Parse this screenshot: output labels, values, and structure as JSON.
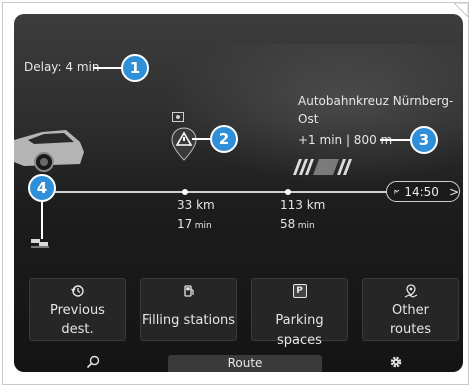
{
  "delay": {
    "label": "Delay: 4 min"
  },
  "destination": {
    "name_line1": "Autobahnkreuz Nürnberg-",
    "name_line2": "Ost",
    "info": "+1 min | 800 m"
  },
  "eta": {
    "time": "14:50",
    "arrow": ">"
  },
  "waypoints": [
    {
      "distance": "33 km",
      "time_value": "17",
      "time_unit": "min"
    },
    {
      "distance": "113 km",
      "time_value": "58",
      "time_unit": "min"
    }
  ],
  "callouts": [
    "1",
    "2",
    "3",
    "4"
  ],
  "actions": [
    {
      "label_line1": "Previous",
      "label_line2": "dest.",
      "icon": "history-icon"
    },
    {
      "label_line1": "Filling stations",
      "label_line2": "",
      "icon": "fuel-icon"
    },
    {
      "label_line1": "Parking spaces",
      "label_line2": "",
      "icon": "parking-icon"
    },
    {
      "label_line1": "Other",
      "label_line2": "routes",
      "icon": "route-pin-icon"
    }
  ],
  "bottom_bar": {
    "tab_label": "Route",
    "left_icon": "search-icon",
    "right_icon": "settings-icon"
  },
  "parking_icon_letter": "P",
  "colors": {
    "callout": "#2f8fd8",
    "background": "#1c1c1c",
    "text": "#e6e6e6"
  }
}
